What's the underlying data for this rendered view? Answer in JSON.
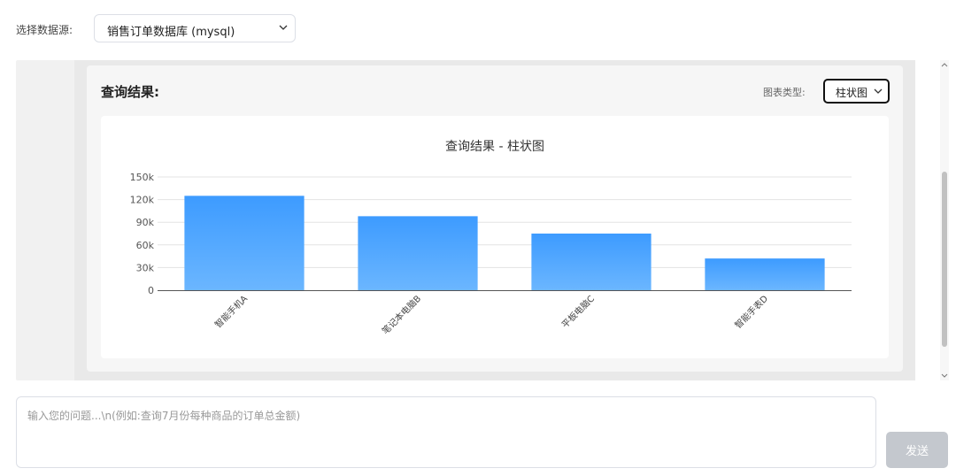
{
  "datasource": {
    "label": "选择数据源:",
    "selected": "销售订单数据库 (mysql)"
  },
  "result": {
    "title": "查询结果:",
    "chart_type_label": "图表类型:",
    "chart_type_selected": "柱状图"
  },
  "chart_data": {
    "type": "bar",
    "title": "查询结果 - 柱状图",
    "categories": [
      "智能手机A",
      "笔记本电脑B",
      "平板电脑C",
      "智能手表D"
    ],
    "values": [
      125000,
      98000,
      75000,
      42000
    ],
    "ylim": [
      0,
      150000
    ],
    "yticks": [
      0,
      30000,
      60000,
      90000,
      120000,
      150000
    ],
    "ytick_labels": [
      "0",
      "30k",
      "60k",
      "90k",
      "120k",
      "150k"
    ],
    "xlabel": "",
    "ylabel": "",
    "grid": true,
    "bar_color_top": "#3d9bff",
    "bar_color_bottom": "#6bb6ff"
  },
  "query": {
    "placeholder": "输入您的问题...\\n(例如:查询7月份每种商品的订单总金额)",
    "value": ""
  },
  "send_button": {
    "label": "发送"
  },
  "colors": {
    "accent": "#3d9bff",
    "button_disabled": "#c4c8ce"
  }
}
